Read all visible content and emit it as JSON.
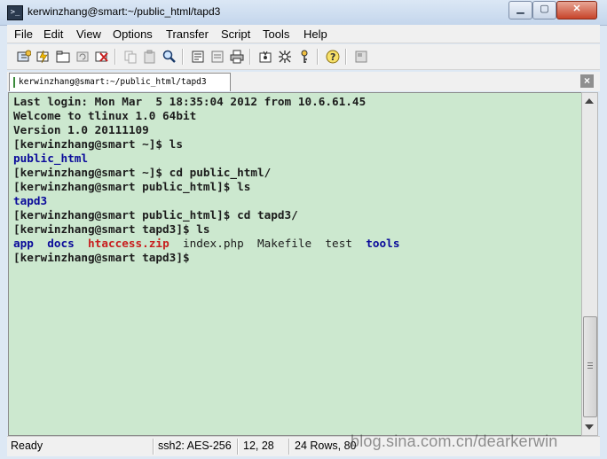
{
  "window": {
    "title": "kerwinzhang@smart:~/public_html/tapd3",
    "controls": {
      "minimize": "▁",
      "maximize": "▢",
      "close": "✕"
    }
  },
  "menu": {
    "items": [
      {
        "label": "File",
        "name": "menu-file"
      },
      {
        "label": "Edit",
        "name": "menu-edit"
      },
      {
        "label": "View",
        "name": "menu-view"
      },
      {
        "label": "Options",
        "name": "menu-options"
      },
      {
        "label": "Transfer",
        "name": "menu-transfer"
      },
      {
        "label": "Script",
        "name": "menu-script"
      },
      {
        "label": "Tools",
        "name": "menu-tools"
      },
      {
        "label": "Help",
        "name": "menu-help"
      }
    ]
  },
  "toolbar": {
    "icons": [
      "connect-icon",
      "quick-connect-icon",
      "connect-in-tab-icon",
      "reconnect-icon",
      "disconnect-icon",
      "copy-icon",
      "paste-icon",
      "find-icon",
      "print-icon",
      "print-setup-icon",
      "printer-icon",
      "session-options-icon",
      "global-options-icon",
      "keymap-icon",
      "help-icon",
      "sftp-icon"
    ]
  },
  "tab": {
    "label": "kerwinzhang@smart:~/public_html/tapd3",
    "close_label": "×"
  },
  "terminal": {
    "lines": [
      "Last login: Mon Mar  5 18:35:04 2012 from 10.6.61.45",
      "Welcome to tlinux 1.0 64bit",
      "Version 1.0 20111109",
      "[kerwinzhang@smart ~]$ ls",
      "public_html",
      "[kerwinzhang@smart ~]$ cd public_html/",
      "[kerwinzhang@smart public_html]$ ls",
      "tapd3",
      "[kerwinzhang@smart public_html]$ cd tapd3/",
      "[kerwinzhang@smart tapd3]$ ls",
      "",
      "[kerwinzhang@smart tapd3]$"
    ],
    "ls_output": {
      "app": "app",
      "docs": "docs",
      "htaccess": "htaccess.zip",
      "index": "index.php",
      "makefile": "Makefile",
      "test": "test",
      "tools": "tools"
    },
    "colors": {
      "background": "#cce8cf",
      "directory": "#0a0a9a",
      "archive": "#c81e1e"
    }
  },
  "status": {
    "ready": "Ready",
    "cipher": "ssh2: AES-256",
    "cursor": "12,  28",
    "size": "24 Rows,  80",
    "watermark": "blog.sina.com.cn/dearkerwin"
  }
}
